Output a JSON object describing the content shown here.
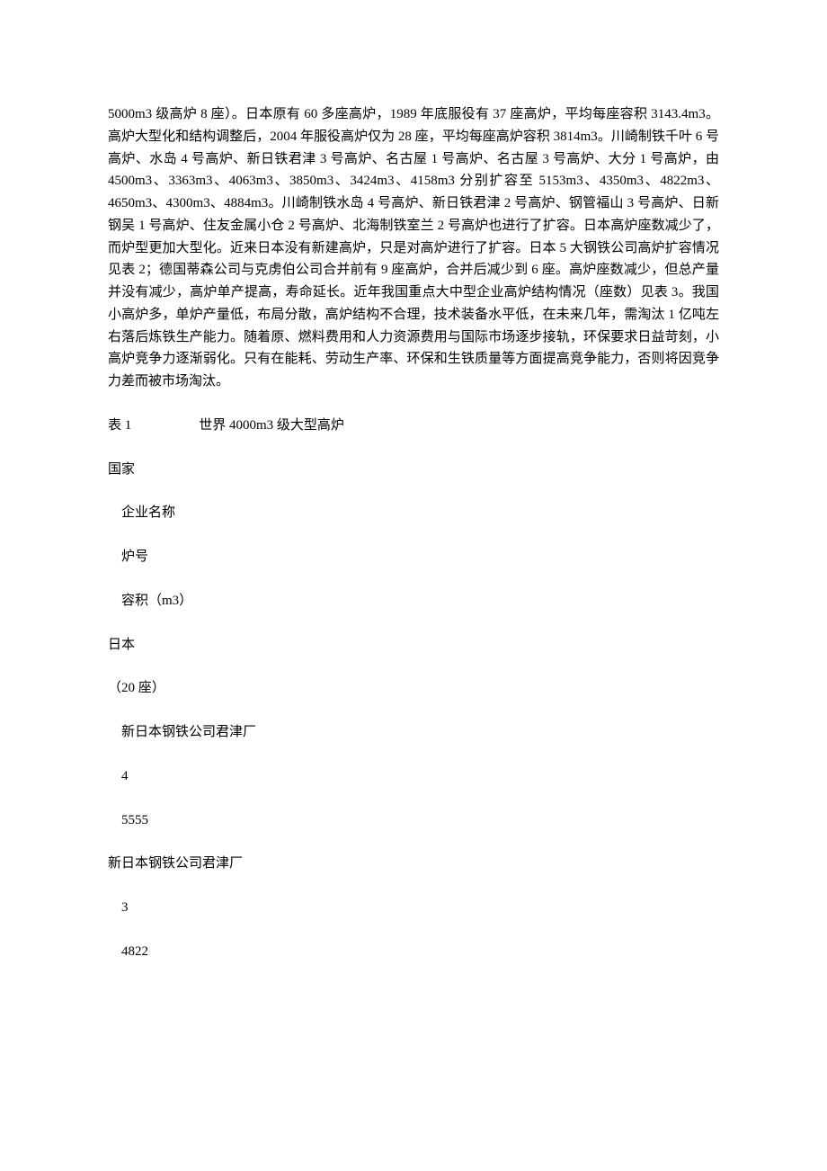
{
  "paragraph1": "5000m3 级高炉 8 座）。日本原有 60 多座高炉，1989 年底服役有 37 座高炉，平均每座容积 3143.4m3。高炉大型化和结构调整后，2004 年服役高炉仅为 28 座，平均每座高炉容积 3814m3。川崎制铁千叶 6 号高炉、水岛 4 号高炉、新日铁君津 3 号高炉、名古屋 1 号高炉、名古屋 3 号高炉、大分 1 号高炉，由 4500m3、3363m3、4063m3、3850m3、3424m3、4158m3 分别扩容至 5153m3、4350m3、4822m3、4650m3、4300m3、4884m3。川崎制铁水岛 4 号高炉、新日铁君津 2 号高炉、钢管福山 3 号高炉、日新钢吴 1 号高炉、住友金属小仓 2 号高炉、北海制铁室兰 2 号高炉也进行了扩容。日本高炉座数减少了，而炉型更加大型化。近来日本没有新建高炉，只是对高炉进行了扩容。日本 5 大钢铁公司高炉扩容情况见表 2；德国蒂森公司与克虏伯公司合并前有 9 座高炉，合并后减少到 6 座。高炉座数减少，但总产量并没有减少，高炉单产提高，寿命延长。近年我国重点大中型企业高炉结构情况（座数）见表 3。我国小高炉多，单炉产量低，布局分散，高炉结构不合理，技术装备水平低，在未来几年，需淘汰 1 亿吨左右落后炼铁生产能力。随着原、燃料费用和人力资源费用与国际市场逐步接轨，环保要求日益苛刻，小高炉竞争力逐渐弱化。只有在能耗、劳动生产率、环保和生铁质量等方面提高竞争能力，否则将因竞争力差而被市场淘汰。",
  "table1_heading": "表 1　　　　　世界 4000m3 级大型高炉",
  "headers": {
    "country": "国家",
    "company": "　企业名称",
    "furnace_no": "　炉号",
    "volume": "　容积（m3）"
  },
  "japan": {
    "label": "日本",
    "count": "（20 座）",
    "entries": [
      {
        "company": "　新日本钢铁公司君津厂",
        "furnace_no": "　4",
        "volume": "　5555"
      },
      {
        "company": "新日本钢铁公司君津厂",
        "furnace_no": "　3",
        "volume": "　4822"
      }
    ]
  }
}
